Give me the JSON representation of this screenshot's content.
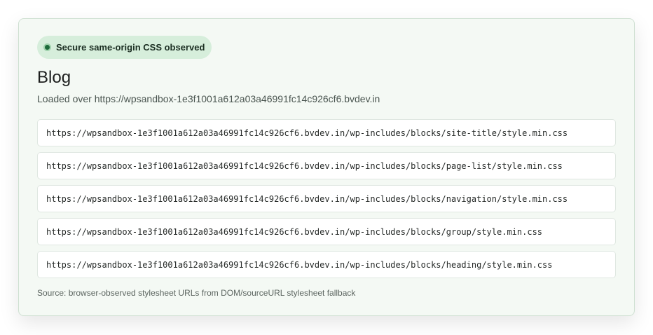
{
  "status_badge": {
    "label": "Secure same-origin CSS observed",
    "color": "#1d6b3a"
  },
  "page": {
    "title": "Blog",
    "subtitle": "Loaded over https://wpsandbox-1e3f1001a612a03a46991fc14c926cf6.bvdev.in"
  },
  "stylesheets": [
    "https://wpsandbox-1e3f1001a612a03a46991fc14c926cf6.bvdev.in/wp-includes/blocks/site-title/style.min.css",
    "https://wpsandbox-1e3f1001a612a03a46991fc14c926cf6.bvdev.in/wp-includes/blocks/page-list/style.min.css",
    "https://wpsandbox-1e3f1001a612a03a46991fc14c926cf6.bvdev.in/wp-includes/blocks/navigation/style.min.css",
    "https://wpsandbox-1e3f1001a612a03a46991fc14c926cf6.bvdev.in/wp-includes/blocks/group/style.min.css",
    "https://wpsandbox-1e3f1001a612a03a46991fc14c926cf6.bvdev.in/wp-includes/blocks/heading/style.min.css"
  ],
  "footer": {
    "source_note": "Source: browser-observed stylesheet URLs from DOM/sourceURL stylesheet fallback"
  }
}
